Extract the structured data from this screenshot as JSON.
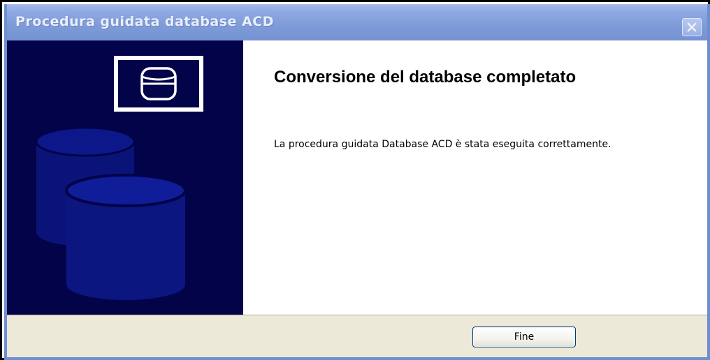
{
  "window": {
    "title": "Procedura guidata database ACD"
  },
  "side_panel": {
    "logo_icon": "database-icon",
    "background_art": "stacked-database-cylinders"
  },
  "main": {
    "heading": "Conversione del database completato",
    "message": "La procedura guidata Database ACD è stata eseguita correttamente."
  },
  "footer": {
    "finish_label": "Fine"
  },
  "colors": {
    "side_panel_bg": "#03034a",
    "titlebar": "#7e9bd8",
    "footer_bg": "#ece9d8"
  }
}
